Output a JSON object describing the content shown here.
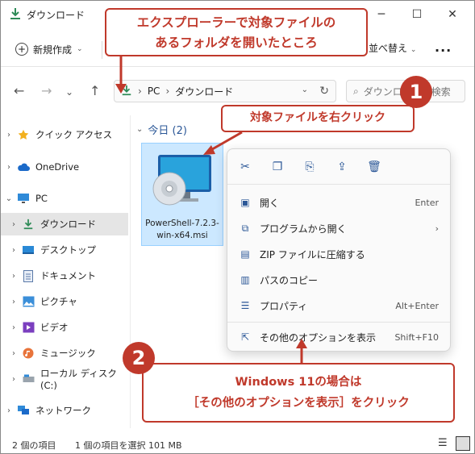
{
  "window": {
    "title": "ダウンロード",
    "controls": [
      "minimize",
      "maximize",
      "close"
    ]
  },
  "toolbar": {
    "new_label": "新規作成",
    "sort_label": "並べ替え",
    "more_label": "..."
  },
  "address": {
    "segments": [
      "PC",
      "ダウンロード"
    ],
    "search_placeholder": "ダウンロードの検索"
  },
  "sidebar": {
    "items": [
      {
        "label": "クイック アクセス",
        "icon": "star-icon",
        "chevron": "›"
      },
      {
        "label": "OneDrive",
        "icon": "cloud-icon",
        "chevron": "›"
      },
      {
        "label": "PC",
        "icon": "monitor-icon",
        "chevron": "⌄"
      },
      {
        "label": "ダウンロード",
        "icon": "download-icon",
        "chevron": "›",
        "selected": true
      },
      {
        "label": "デスクトップ",
        "icon": "desktop-icon",
        "chevron": "›"
      },
      {
        "label": "ドキュメント",
        "icon": "document-icon",
        "chevron": "›"
      },
      {
        "label": "ピクチャ",
        "icon": "pictures-icon",
        "chevron": "›"
      },
      {
        "label": "ビデオ",
        "icon": "video-icon",
        "chevron": "›"
      },
      {
        "label": "ミュージック",
        "icon": "music-icon",
        "chevron": "›"
      },
      {
        "label": "ローカル ディスク (C:)",
        "icon": "drive-icon",
        "chevron": "›"
      },
      {
        "label": "ネットワーク",
        "icon": "network-icon",
        "chevron": "›"
      }
    ]
  },
  "content": {
    "group_label": "今日 (2)",
    "file": {
      "name_line1": "PowerShell-7.2.3-",
      "name_line2": "win-x64.msi"
    }
  },
  "context_menu": {
    "quick_actions": [
      "cut-icon",
      "copy-icon",
      "rename-icon",
      "share-icon",
      "delete-icon"
    ],
    "items": [
      {
        "label": "開く",
        "shortcut": "Enter",
        "icon": "open-icon"
      },
      {
        "label": "プログラムから開く",
        "shortcut": "›",
        "icon": "open-with-icon"
      },
      {
        "label": "ZIP ファイルに圧縮する",
        "shortcut": "",
        "icon": "zip-icon"
      },
      {
        "label": "パスのコピー",
        "shortcut": "",
        "icon": "copy-path-icon"
      },
      {
        "label": "プロパティ",
        "shortcut": "Alt+Enter",
        "icon": "properties-icon"
      },
      {
        "label": "その他のオプションを表示",
        "shortcut": "Shift+F10",
        "icon": "more-options-icon"
      }
    ]
  },
  "status": {
    "count": "2 個の項目",
    "selection": "1 個の項目を選択  101 MB"
  },
  "annotations": {
    "callout1_line1": "エクスプローラーで対象ファイルの",
    "callout1_line2": "あるフォルダを開いたところ",
    "callout2": "対象ファイルを右クリック",
    "callout3_line1": "Windows 11の場合は",
    "callout3_line2": "［その他のオプションを表示］をクリック",
    "badge1": "1",
    "badge2": "2"
  },
  "colors": {
    "accent": "#c0392b",
    "selection": "#cce8ff",
    "link": "#2b5797"
  }
}
